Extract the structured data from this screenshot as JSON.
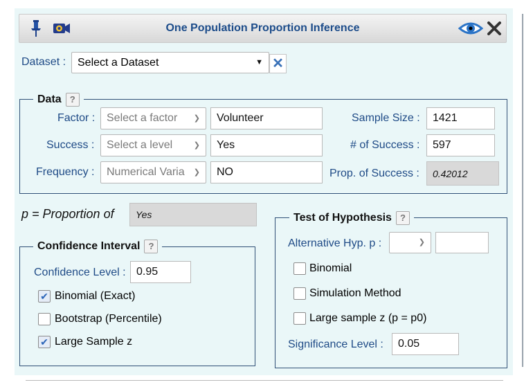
{
  "header": {
    "title": "One Population Proportion Inference",
    "pin_icon": "pin-icon",
    "video_icon": "video-icon",
    "eye_icon": "eye-icon",
    "close_icon": "close-icon"
  },
  "dataset": {
    "label": "Dataset :",
    "selected": "Select a Dataset",
    "clear_icon": "✕"
  },
  "data_section": {
    "legend": "Data",
    "help": "?",
    "factor": {
      "label": "Factor :",
      "select": "Select a factor",
      "value": "Volunteer"
    },
    "success": {
      "label": "Success :",
      "select": "Select a level",
      "value": "Yes"
    },
    "frequency": {
      "label": "Frequency :",
      "select": "Numerical Varia",
      "value": "NO"
    },
    "sample_size": {
      "label": "Sample Size :",
      "value": "1421"
    },
    "num_success": {
      "label": "# of Success :",
      "value": "597"
    },
    "prop_success": {
      "label": "Prop. of Success :",
      "value": "0.42012"
    }
  },
  "proportion": {
    "label": "p = Proportion of",
    "value": "Yes"
  },
  "confidence_interval": {
    "legend": "Confidence Interval",
    "help": "?",
    "level_label": "Confidence Level :",
    "level_value": "0.95",
    "options": [
      {
        "label": "Binomial (Exact)",
        "checked": true
      },
      {
        "label": "Bootstrap (Percentile)",
        "checked": false
      },
      {
        "label": "Large Sample z",
        "checked": true
      }
    ]
  },
  "test_of_hypothesis": {
    "legend": "Test of Hypothesis",
    "help": "?",
    "alt_label": "Alternative Hyp. p :",
    "alt_value": "",
    "options": [
      {
        "label": "Binomial",
        "checked": false
      },
      {
        "label": "Simulation Method",
        "checked": false
      },
      {
        "label": "Large sample z (p = p0)",
        "checked": false
      }
    ],
    "sig_label": "Significance Level :",
    "sig_value": "0.05"
  },
  "colors": {
    "panel_bg": "#eaf7f8",
    "label_blue": "#1e4a86",
    "title_blue": "#1c4c8a"
  }
}
